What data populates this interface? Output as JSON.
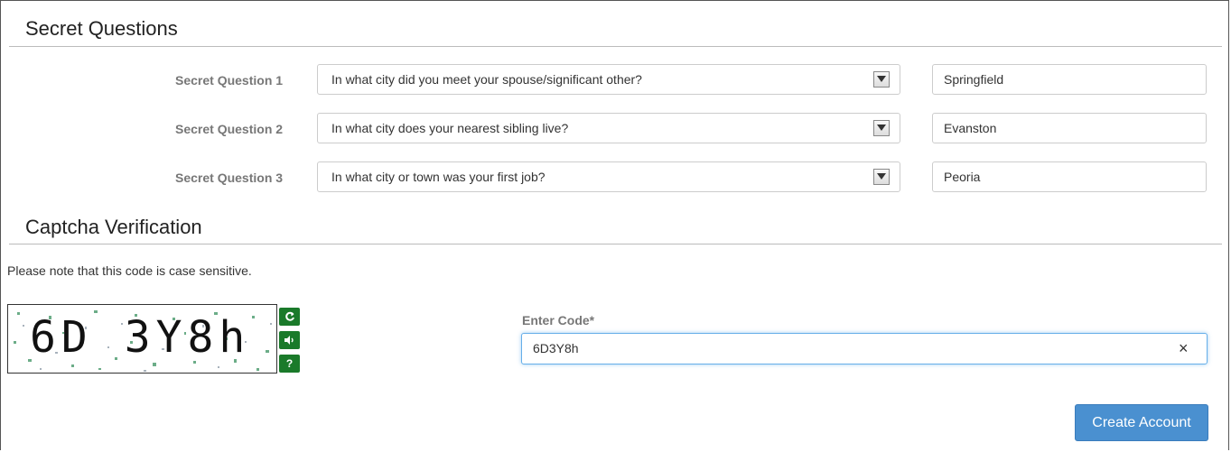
{
  "secret_questions": {
    "title": "Secret Questions",
    "rows": [
      {
        "label": "Secret Question 1",
        "question": "In what city did you meet your spouse/significant other?",
        "answer": "Springfield"
      },
      {
        "label": "Secret Question 2",
        "question": "In what city does your nearest sibling live?",
        "answer": "Evanston"
      },
      {
        "label": "Secret Question 3",
        "question": "In what city or town was your first job?",
        "answer": "Peoria"
      }
    ]
  },
  "captcha": {
    "title": "Captcha Verification",
    "note": "Please note that this code is case sensitive.",
    "image_text": "6D 3Y8h",
    "refresh_icon": "refresh-icon",
    "audio_icon": "audio-icon",
    "help_icon": "help-icon",
    "help_glyph": "?",
    "code_label": "Enter Code*",
    "code_value": "6D3Y8h",
    "clear_glyph": "×"
  },
  "actions": {
    "create_account": "Create Account"
  },
  "colors": {
    "primary_button": "#4a90d0",
    "captcha_button": "#1a7a2a",
    "focus_border": "#66afe9"
  }
}
